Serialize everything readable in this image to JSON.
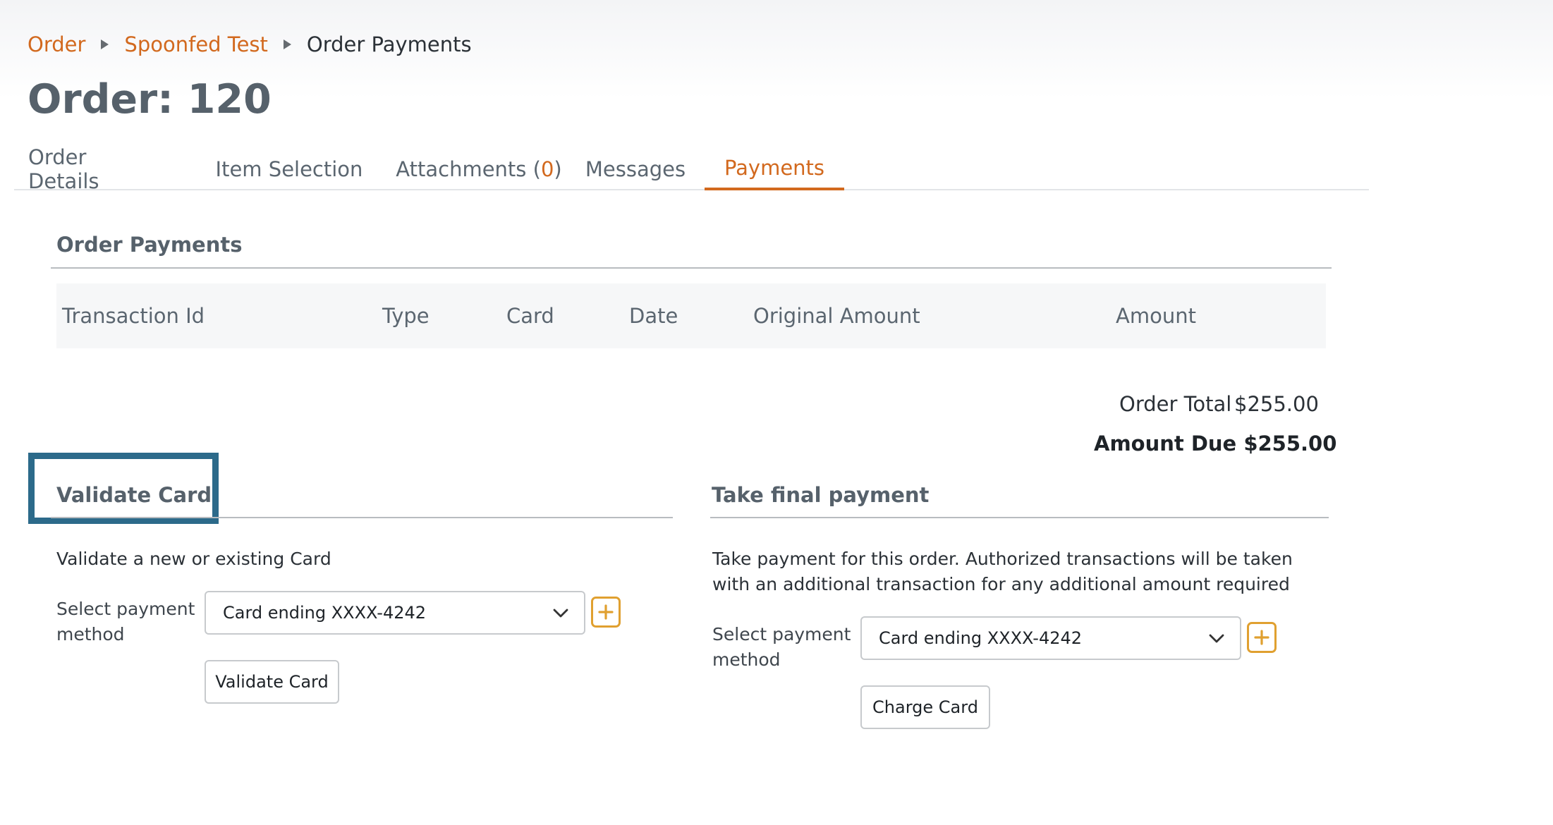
{
  "breadcrumb": {
    "items": [
      "Order",
      "Spoonfed Test",
      "Order Payments"
    ]
  },
  "page": {
    "title": "Order: 120"
  },
  "tabs": {
    "order_details": "Order Details",
    "item_selection": "Item Selection",
    "attachments_label": "Attachments (",
    "attachments_count": "0",
    "attachments_close": ")",
    "messages": "Messages",
    "payments": "Payments",
    "active": "Payments"
  },
  "order_payments": {
    "heading": "Order Payments",
    "columns": [
      "Transaction Id",
      "Type",
      "Card",
      "Date",
      "Original Amount",
      "Amount"
    ],
    "rows": [],
    "order_total_label": "Order Total",
    "order_total_value": "$255.00",
    "amount_due": "Amount Due $255.00"
  },
  "validate_card": {
    "heading": "Validate Card",
    "description": "Validate a new or existing Card",
    "select_label": "Select payment method",
    "selected_method": "Card ending XXXX-4242",
    "button": "Validate Card"
  },
  "final_payment": {
    "heading": "Take final payment",
    "description": "Take payment for this order. Authorized transactions will be taken with an additional transaction for any additional amount required",
    "select_label": "Select payment method",
    "selected_method": "Card ending XXXX-4242",
    "button": "Charge Card"
  },
  "colors": {
    "accent": "#d2691e",
    "plus_border": "#e0a030",
    "highlight": "#2c6a8a"
  },
  "icons": {
    "breadcrumb_separator": "triangle-right-icon",
    "dropdown": "chevron-down-icon",
    "add": "plus-icon"
  }
}
